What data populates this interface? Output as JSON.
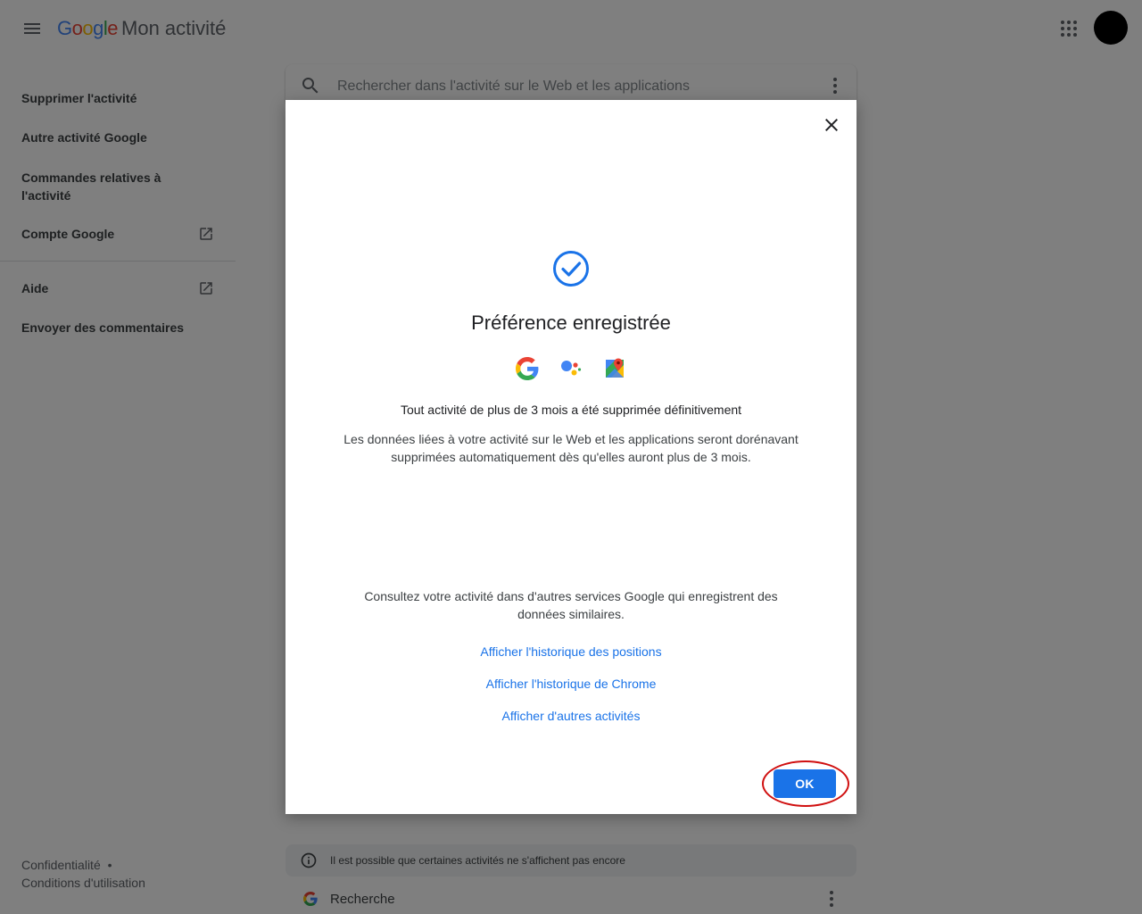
{
  "header": {
    "logo_letters": [
      {
        "ch": "G",
        "color": "#4285F4"
      },
      {
        "ch": "o",
        "color": "#EA4335"
      },
      {
        "ch": "o",
        "color": "#FBBC05"
      },
      {
        "ch": "g",
        "color": "#4285F4"
      },
      {
        "ch": "l",
        "color": "#34A853"
      },
      {
        "ch": "e",
        "color": "#EA4335"
      }
    ],
    "product_name": "Mon activité",
    "menu_icon": "hamburger-menu-icon",
    "apps_icon": "apps-grid-icon"
  },
  "sidebar": {
    "items": [
      {
        "label": "Supprimer l'activité"
      },
      {
        "label": "Autre activité Google"
      },
      {
        "label": "Commandes relatives à l'activité"
      },
      {
        "label": "Compte Google",
        "icon": "open-in-new-icon"
      },
      {
        "label": "Aide",
        "icon": "open-in-new-icon"
      },
      {
        "label": "Envoyer des commentaires"
      }
    ]
  },
  "footer": {
    "privacy": "Confidentialité",
    "separator": "•",
    "terms": "Conditions d'utilisation"
  },
  "search": {
    "placeholder": "Rechercher dans l'activité sur le Web et les applications"
  },
  "notice": {
    "text": "Il est possible que certaines activités ne s'affichent pas encore"
  },
  "activity_row": {
    "title": "Recherche"
  },
  "dialog": {
    "title": "Préférence enregistrée",
    "message_deleted": "Tout activité de plus de 3 mois a été supprimée définitivement",
    "message_auto": "Les données liées à votre activité sur le Web et les applications seront dorénavant supprimées automatiquement dès qu'elles auront plus de 3 mois.",
    "message_other": "Consultez votre activité dans d'autres services Google qui enregistrent des données similaires.",
    "links": [
      "Afficher l'historique des positions",
      "Afficher l'historique de Chrome",
      "Afficher d'autres activités"
    ],
    "ok_label": "OK",
    "product_icons": [
      "google-search-icon",
      "google-assistant-icon",
      "google-maps-icon"
    ]
  },
  "colors": {
    "accent": "#1a73e8",
    "highlight": "#d01010",
    "check": "#1a73e8"
  }
}
